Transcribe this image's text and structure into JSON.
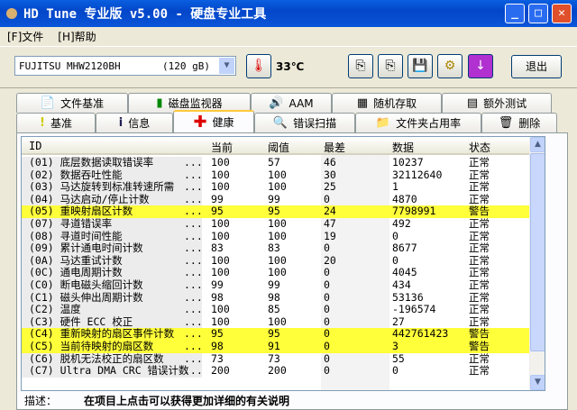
{
  "window": {
    "title": "HD Tune 专业版 v5.00 - 硬盘专业工具"
  },
  "menu": [
    "[F]文件",
    "[H]帮助"
  ],
  "toolbar": {
    "drive": "FUJITSU MHW2120BH",
    "capacity": "(120 gB)",
    "temperature": "33℃",
    "exit_label": "退出"
  },
  "tabs_top": [
    {
      "label": "文件基准",
      "icon": "file-benchmark-icon"
    },
    {
      "label": "磁盘监视器",
      "icon": "disk-monitor-icon"
    },
    {
      "label": "AAM",
      "icon": "speaker-icon"
    },
    {
      "label": "随机存取",
      "icon": "random-access-icon"
    },
    {
      "label": "额外测试",
      "icon": "extra-tests-icon"
    }
  ],
  "tabs_bottom": [
    {
      "label": "基准",
      "icon": "exclamation-icon"
    },
    {
      "label": "信息",
      "icon": "info-icon"
    },
    {
      "label": "健康",
      "icon": "red-cross-icon",
      "active": true
    },
    {
      "label": "错误扫描",
      "icon": "magnifier-icon"
    },
    {
      "label": "文件夹占用率",
      "icon": "folder-icon"
    },
    {
      "label": "删除",
      "icon": "trash-icon"
    }
  ],
  "table": {
    "columns": [
      "ID",
      "当前",
      "阈值",
      "最差",
      "数据",
      "状态"
    ],
    "rows": [
      [
        "(01) 底层数据读取错误率",
        "100",
        "57",
        "46",
        "10237",
        "正常"
      ],
      [
        "(02) 数据吞吐性能",
        "100",
        "100",
        "30",
        "32112640",
        "正常"
      ],
      [
        "(03) 马达旋转到标准转速所需",
        "100",
        "100",
        "25",
        "1",
        "正常"
      ],
      [
        "(04) 马达启动/停止计数",
        "99",
        "99",
        "0",
        "4870",
        "正常"
      ],
      [
        "(05) 重映射扇区计数",
        "95",
        "95",
        "24",
        "7798991",
        "警告"
      ],
      [
        "(07) 寻道错误率",
        "100",
        "100",
        "47",
        "492",
        "正常"
      ],
      [
        "(08) 寻道时间性能",
        "100",
        "100",
        "19",
        "0",
        "正常"
      ],
      [
        "(09) 累计通电时间计数",
        "83",
        "83",
        "0",
        "8677",
        "正常"
      ],
      [
        "(0A) 马达重试计数",
        "100",
        "100",
        "20",
        "0",
        "正常"
      ],
      [
        "(0C) 通电周期计数",
        "100",
        "100",
        "0",
        "4045",
        "正常"
      ],
      [
        "(C0) 断电磁头缩回计数",
        "99",
        "99",
        "0",
        "434",
        "正常"
      ],
      [
        "(C1) 磁头伸出周期计数",
        "98",
        "98",
        "0",
        "53136",
        "正常"
      ],
      [
        "(C2) 温度",
        "100",
        "85",
        "0",
        "-196574",
        "正常"
      ],
      [
        "(C3) 硬件 ECC 校正",
        "100",
        "100",
        "0",
        "27",
        "正常"
      ],
      [
        "(C4) 重新映射的扇区事件计数",
        "95",
        "95",
        "0",
        "442761423",
        "警告"
      ],
      [
        "(C5) 当前待映射的扇区数",
        "98",
        "91",
        "0",
        "3",
        "警告"
      ],
      [
        "(C6) 脱机无法校正的扇区数",
        "73",
        "73",
        "0",
        "55",
        "正常"
      ],
      [
        "(C7) Ultra DMA CRC 错误计数",
        "200",
        "200",
        "0",
        "0",
        "正常"
      ]
    ],
    "ellipsis": "...",
    "warn_color": "#ffff3a"
  },
  "description": {
    "label": "描述：",
    "text": "在项目上点击可以获得更加详细的有关说明"
  }
}
